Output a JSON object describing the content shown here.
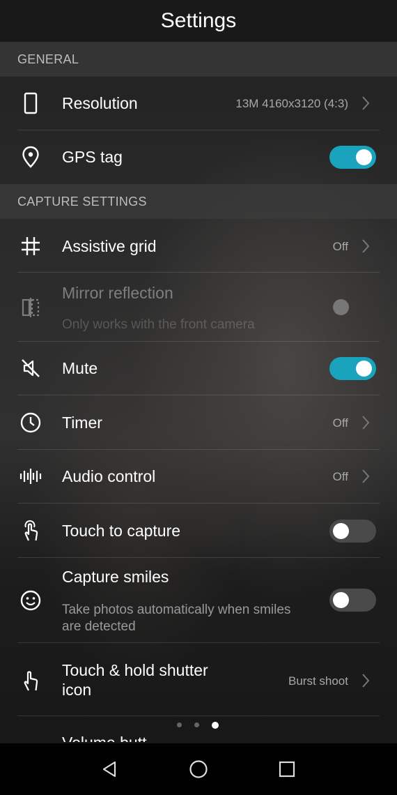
{
  "header": {
    "title": "Settings"
  },
  "sections": {
    "general": "GENERAL",
    "capture": "CAPTURE SETTINGS"
  },
  "items": {
    "resolution": {
      "label": "Resolution",
      "value": "13M 4160x3120 (4:3)",
      "icon": "phone-outline-icon"
    },
    "gps": {
      "label": "GPS tag",
      "state": "on",
      "icon": "location-pin-icon"
    },
    "grid": {
      "label": "Assistive grid",
      "value": "Off",
      "icon": "grid-hash-icon"
    },
    "mirror": {
      "label": "Mirror reflection",
      "sub": "Only works with the front camera",
      "state": "disabled",
      "icon": "mirror-icon"
    },
    "mute": {
      "label": "Mute",
      "state": "on",
      "icon": "speaker-mute-icon"
    },
    "timer": {
      "label": "Timer",
      "value": "Off",
      "icon": "clock-icon"
    },
    "audio": {
      "label": "Audio control",
      "value": "Off",
      "icon": "audio-waveform-icon"
    },
    "touch_capture": {
      "label": "Touch to capture",
      "state": "off",
      "icon": "touch-hand-icon"
    },
    "smiles": {
      "label": "Capture smiles",
      "sub_line1": "Take photos automatically when smiles",
      "sub_line2": "are detected",
      "state": "off",
      "icon": "smiley-icon"
    },
    "hold_shutter": {
      "label_line1": "Touch & hold shutter",
      "label_line2": "icon",
      "value": "Burst shoot",
      "icon": "hand-pointer-icon"
    },
    "volume_partial": {
      "label": "Volume butt..."
    }
  },
  "pager": {
    "count": 3,
    "active": 3
  },
  "colors": {
    "accent": "#1aa3bd",
    "toggle_off": "#4a4a4a",
    "header_bg": "#191919"
  },
  "nav": {
    "back": "back-triangle-icon",
    "home": "home-circle-icon",
    "recents": "recents-square-icon"
  }
}
